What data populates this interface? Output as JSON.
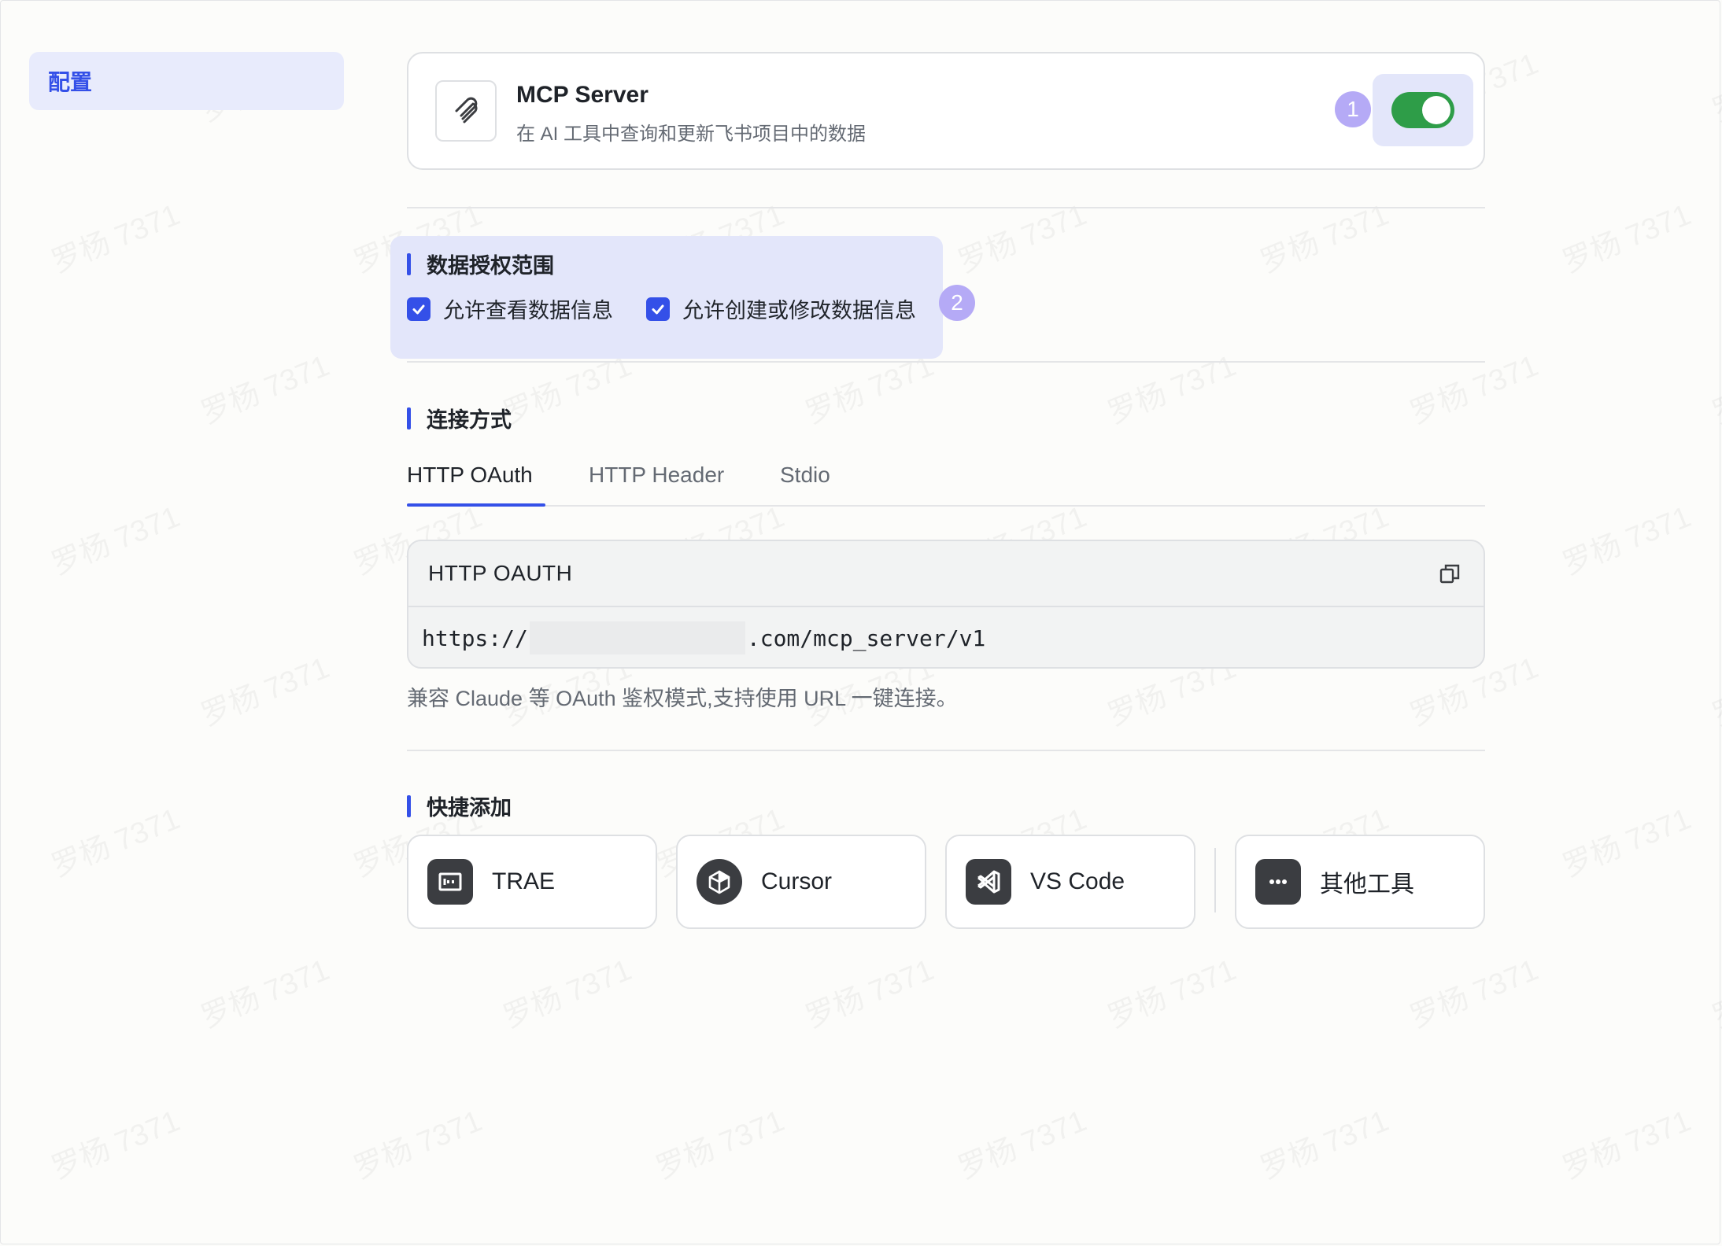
{
  "sidebar": {
    "items": [
      {
        "label": "配置",
        "active": true
      }
    ]
  },
  "mcp_card": {
    "title": "MCP Server",
    "subtitle": "在 AI 工具中查询和更新飞书项目中的数据",
    "icon": "paperclip-icon",
    "enabled": true,
    "badge": "1"
  },
  "scope": {
    "heading": "数据授权范围",
    "badge": "2",
    "options": [
      {
        "label": "允许查看数据信息",
        "checked": true
      },
      {
        "label": "允许创建或修改数据信息",
        "checked": true
      }
    ]
  },
  "connection": {
    "heading": "连接方式",
    "tabs": [
      {
        "label": "HTTP OAuth",
        "active": true
      },
      {
        "label": "HTTP Header",
        "active": false
      },
      {
        "label": "Stdio",
        "active": false
      }
    ],
    "code_title": "HTTP OAUTH",
    "url_prefix": "https://",
    "url_suffix": ".com/mcp_server/v1",
    "hint": "兼容 Claude 等 OAuth 鉴权模式,支持使用 URL 一键连接。"
  },
  "quick_add": {
    "heading": "快捷添加",
    "tools": [
      {
        "label": "TRAE",
        "icon": "trae-icon"
      },
      {
        "label": "Cursor",
        "icon": "cursor-icon"
      },
      {
        "label": "VS Code",
        "icon": "vscode-icon"
      },
      {
        "label": "其他工具",
        "icon": "more-icon"
      }
    ]
  },
  "watermark": "罗杨 7371",
  "colors": {
    "accent": "#3450e8",
    "toggle_on": "#2e9d48",
    "badge": "#b5aaf6",
    "highlight": "#e3e6fa"
  }
}
